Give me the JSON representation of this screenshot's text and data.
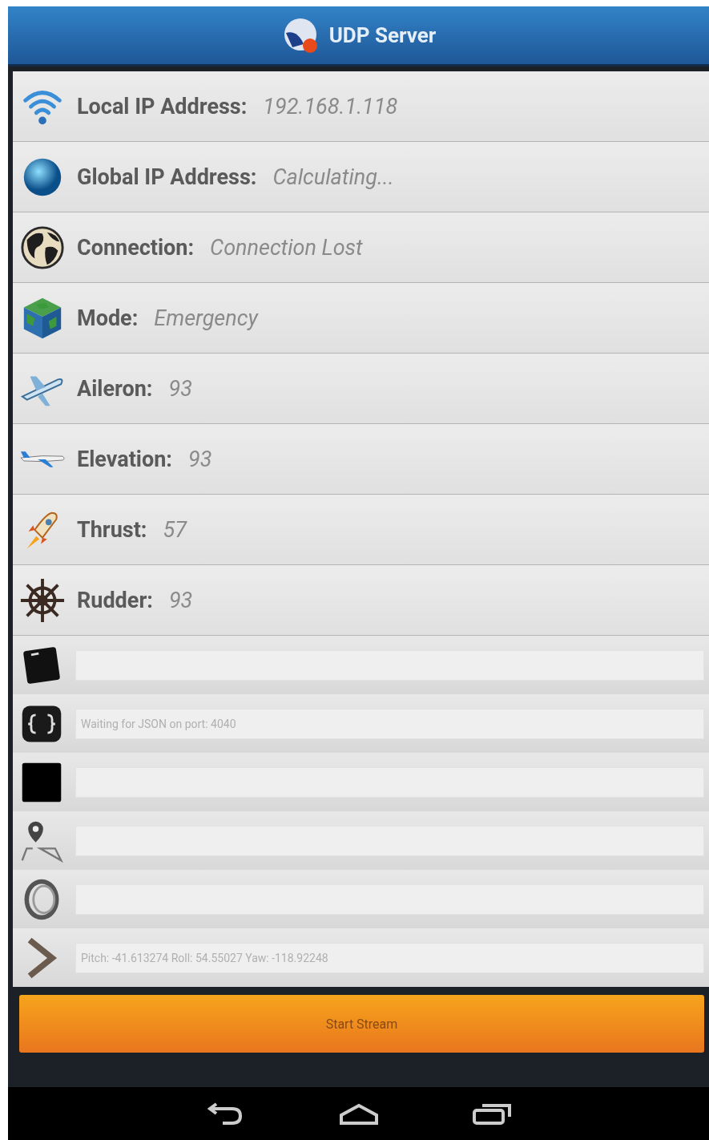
{
  "app_bar": {
    "title": "UDP Server"
  },
  "status_rows": [
    {
      "label": "Local IP Address:",
      "value": "192.168.1.118"
    },
    {
      "label": "Global IP Address:",
      "value": "Calculating..."
    },
    {
      "label": "Connection:",
      "value": "Connection Lost"
    },
    {
      "label": "Mode:",
      "value": "Emergency"
    },
    {
      "label": "Aileron:",
      "value": "93"
    },
    {
      "label": "Elevation:",
      "value": "93"
    },
    {
      "label": "Thrust:",
      "value": "57"
    },
    {
      "label": "Rudder:",
      "value": "93"
    }
  ],
  "field_rows": [
    {
      "kind": "empty"
    },
    {
      "kind": "text",
      "value": "Waiting for JSON on port: 4040"
    },
    {
      "kind": "empty"
    },
    {
      "kind": "empty"
    },
    {
      "kind": "empty"
    },
    {
      "kind": "text",
      "value": "Pitch: -41.613274 Roll: 54.55027 Yaw: -118.92248"
    }
  ],
  "button": {
    "label": "Start Stream"
  }
}
